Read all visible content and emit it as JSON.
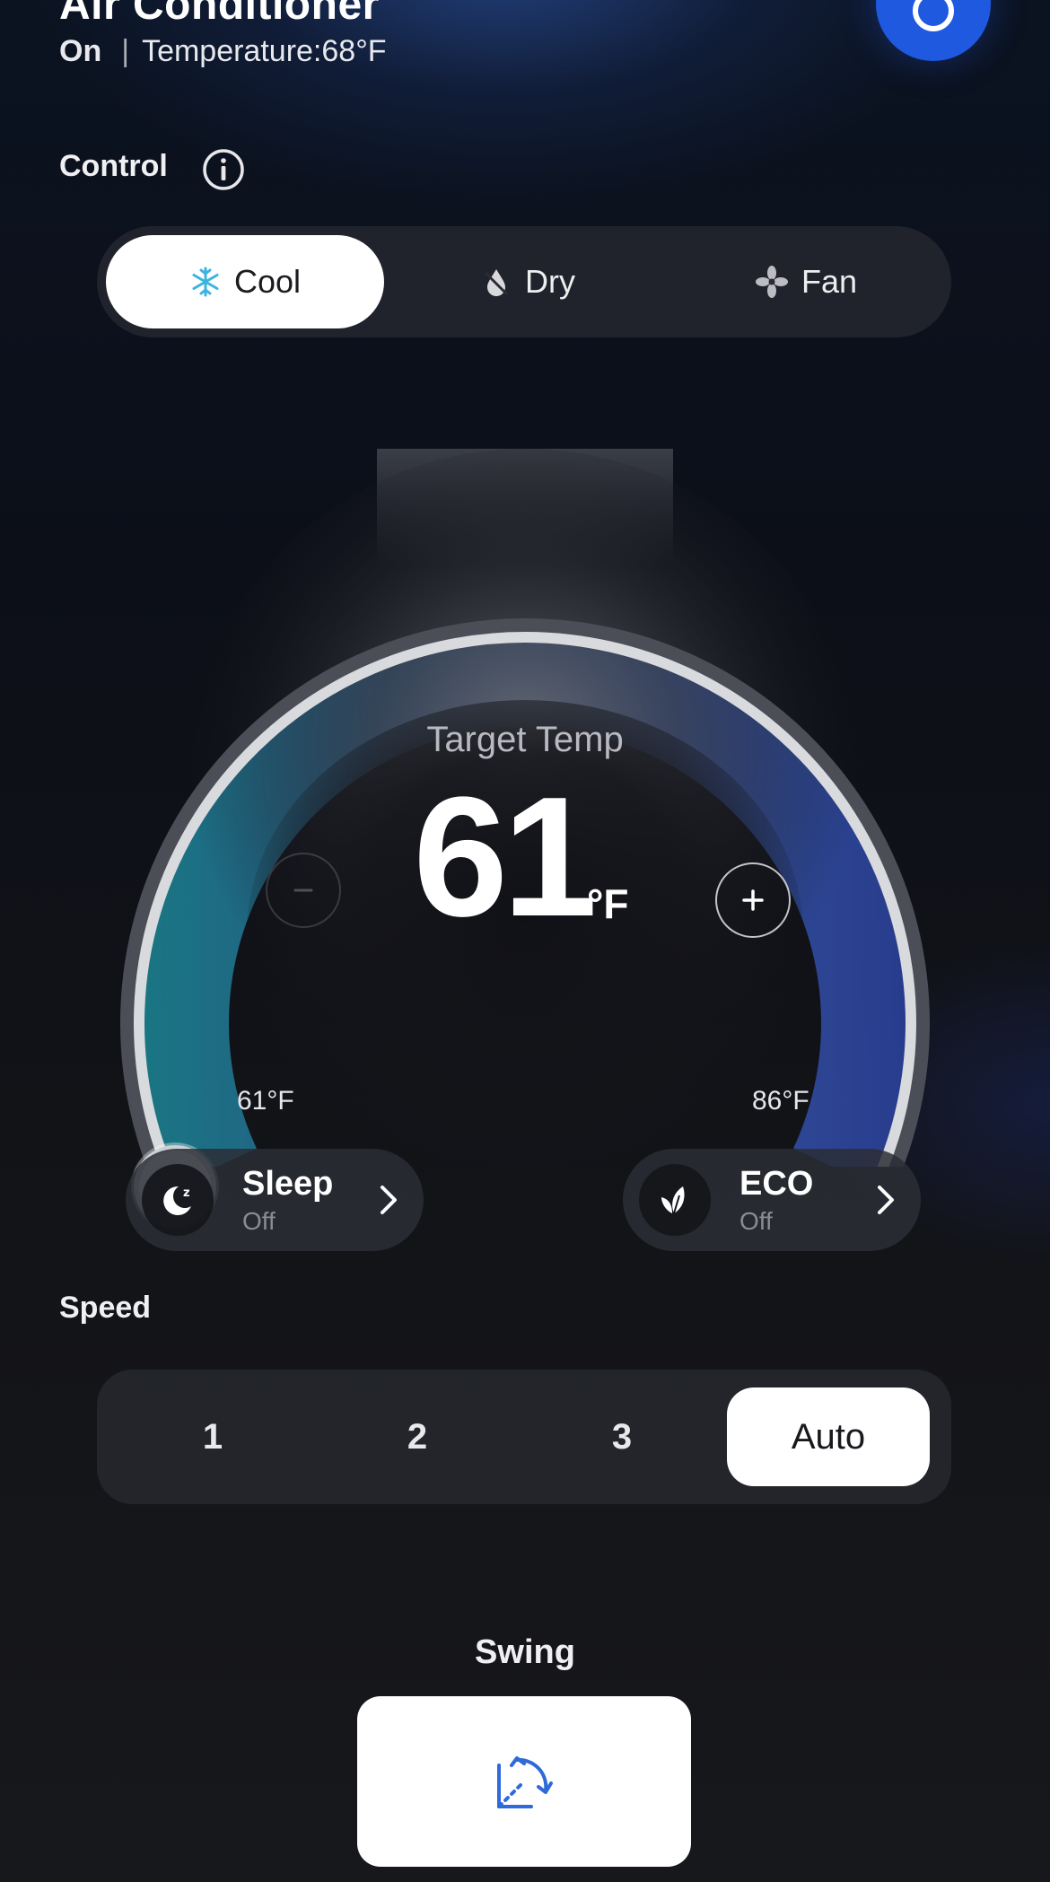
{
  "header": {
    "title": "Air Conditioner",
    "power_state": "On",
    "separator": "|",
    "temperature_text": "Temperature:68°F",
    "power_icon": "power-icon",
    "accent_color": "#1e59e0"
  },
  "control": {
    "label": "Control",
    "info_icon": "info-icon",
    "modes": [
      {
        "label": "Cool",
        "icon": "snowflake-icon",
        "active": true,
        "icon_color": "#3ab4e0"
      },
      {
        "label": "Dry",
        "icon": "drop-icon",
        "active": false
      },
      {
        "label": "Fan",
        "icon": "fan-icon",
        "active": false
      }
    ]
  },
  "dial": {
    "label": "Target Temp",
    "value": "61",
    "unit": "°F",
    "min_label": "61°F",
    "max_label": "86°F",
    "min_value": 61,
    "max_value": 86,
    "current_value": 61,
    "minus_icon": "minus-icon",
    "plus_icon": "plus-icon"
  },
  "features": [
    {
      "title": "Sleep",
      "status": "Off",
      "icon": "moon-icon"
    },
    {
      "title": "ECO",
      "status": "Off",
      "icon": "leaf-icon"
    }
  ],
  "speed": {
    "label": "Speed",
    "options": [
      "1",
      "2",
      "3",
      "Auto"
    ],
    "selected": "Auto"
  },
  "swing": {
    "label": "Swing",
    "icon": "swing-icon",
    "icon_color": "#2f6ad8"
  }
}
